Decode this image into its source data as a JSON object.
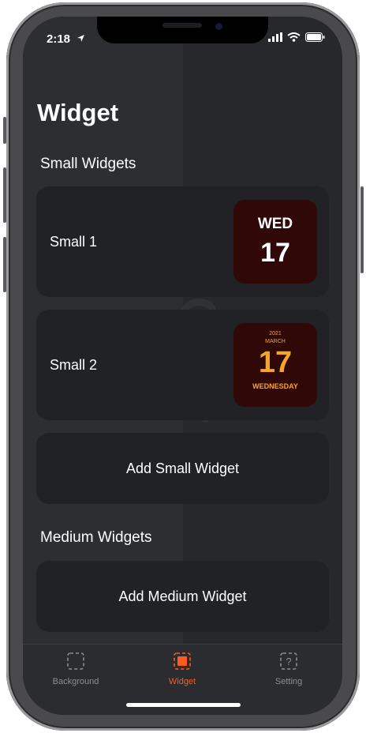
{
  "status_bar": {
    "time": "2:18"
  },
  "page": {
    "title": "Widget"
  },
  "watermark": {
    "text": "OneClear"
  },
  "small_section": {
    "title": "Small Widgets",
    "items": [
      {
        "label": "Small 1",
        "widget": {
          "day": "WED",
          "date": "17"
        }
      },
      {
        "label": "Small 2",
        "widget": {
          "year": "2021",
          "month": "MARCH",
          "date": "17",
          "weekday": "WEDNESDAY"
        }
      }
    ],
    "add_label": "Add Small Widget"
  },
  "medium_section": {
    "title": "Medium Widgets",
    "add_label": "Add Medium Widget"
  },
  "tabs": [
    {
      "label": "Background",
      "icon": "background-icon",
      "active": false
    },
    {
      "label": "Widget",
      "icon": "widget-icon",
      "active": true
    },
    {
      "label": "Setting",
      "icon": "setting-icon",
      "active": false
    }
  ],
  "colors": {
    "accent": "#ff5a1f",
    "widget_bg": "#300808",
    "widget2_text": "#f5a623"
  }
}
